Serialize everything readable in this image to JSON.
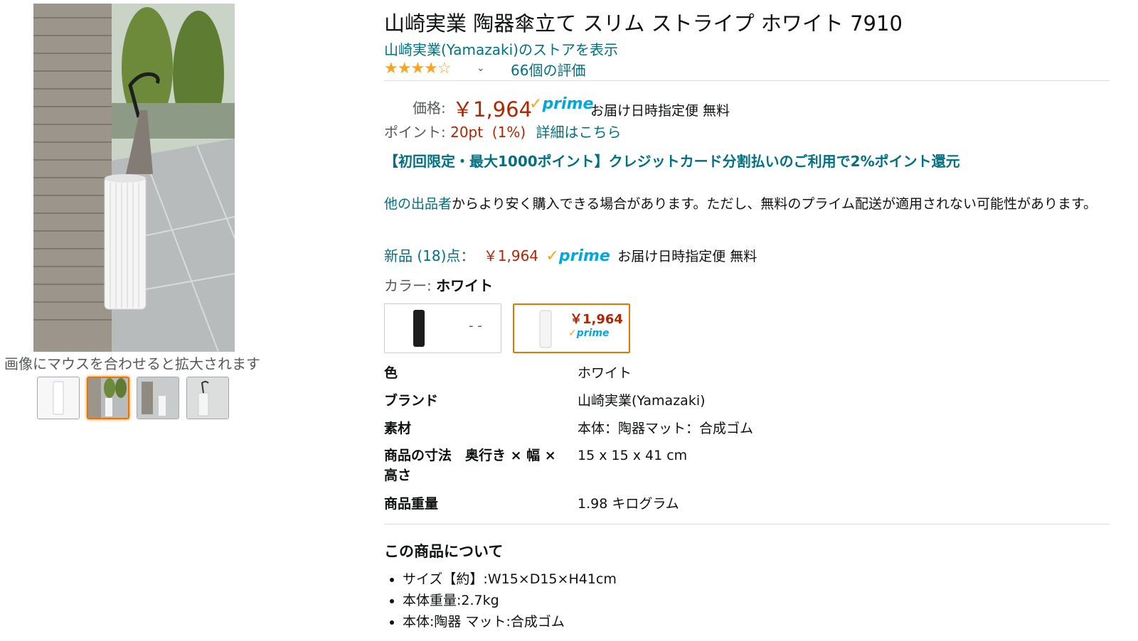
{
  "gallery": {
    "hover_hint": "画像にマウスを合わせると拡大されます",
    "thumbnail_count": 4,
    "selected_thumbnail": 2
  },
  "product": {
    "title": "山崎実業 陶器傘立て スリム ストライプ ホワイト 7910",
    "store_link": "山崎実業(Yamazaki)のストアを表示",
    "rating_stars": "★★★★☆",
    "rating_value": 4,
    "rating_count": "66個の評価"
  },
  "pricing": {
    "price_label": "価格:",
    "price": "￥1,964",
    "prime_badge": "prime",
    "delivery": "お届け日時指定便 無料",
    "points_label": "ポイント:",
    "points_value": "20pt  (1%)",
    "points_link": "詳細はこちら",
    "promo": "【初回限定・最大1000ポイント】クレジットカード分割払いのご利用で2%ポイント還元"
  },
  "offers": {
    "other_sellers_link": "他の出品者",
    "other_sellers_text": "からより安く購入できる場合があります。ただし、無料のプライム配送が適用されない可能性があります。",
    "new_label": "新品 (18)点：",
    "new_price": "￥1,964",
    "new_delivery": "お届け日時指定便 無料"
  },
  "variation": {
    "label": "カラー:",
    "selected": "ホワイト",
    "options": [
      {
        "name": "black",
        "price": "- -",
        "prime": ""
      },
      {
        "name": "white",
        "price": "￥1,964",
        "prime": "prime"
      }
    ]
  },
  "specs": [
    {
      "key": "色",
      "value": "ホワイト"
    },
    {
      "key": "ブランド",
      "value": "山崎実業(Yamazaki)"
    },
    {
      "key": "素材",
      "value": "本体：陶器マット：合成ゴム"
    },
    {
      "key": "商品の寸法　奥行き × 幅 × 高さ",
      "value": "15 x 15 x 41 cm"
    },
    {
      "key": "商品重量",
      "value": "1.98 キログラム"
    }
  ],
  "about": {
    "heading": "この商品について",
    "bullets": [
      "サイズ【約】:W15×D15×H41cm",
      "本体重量:2.7kg",
      "本体:陶器 マット:合成ゴム"
    ]
  },
  "colors": {
    "link": "#007185",
    "price": "#b12704",
    "accent": "#e77600",
    "star": "#ffa41c",
    "prime": "#00a8e1"
  }
}
